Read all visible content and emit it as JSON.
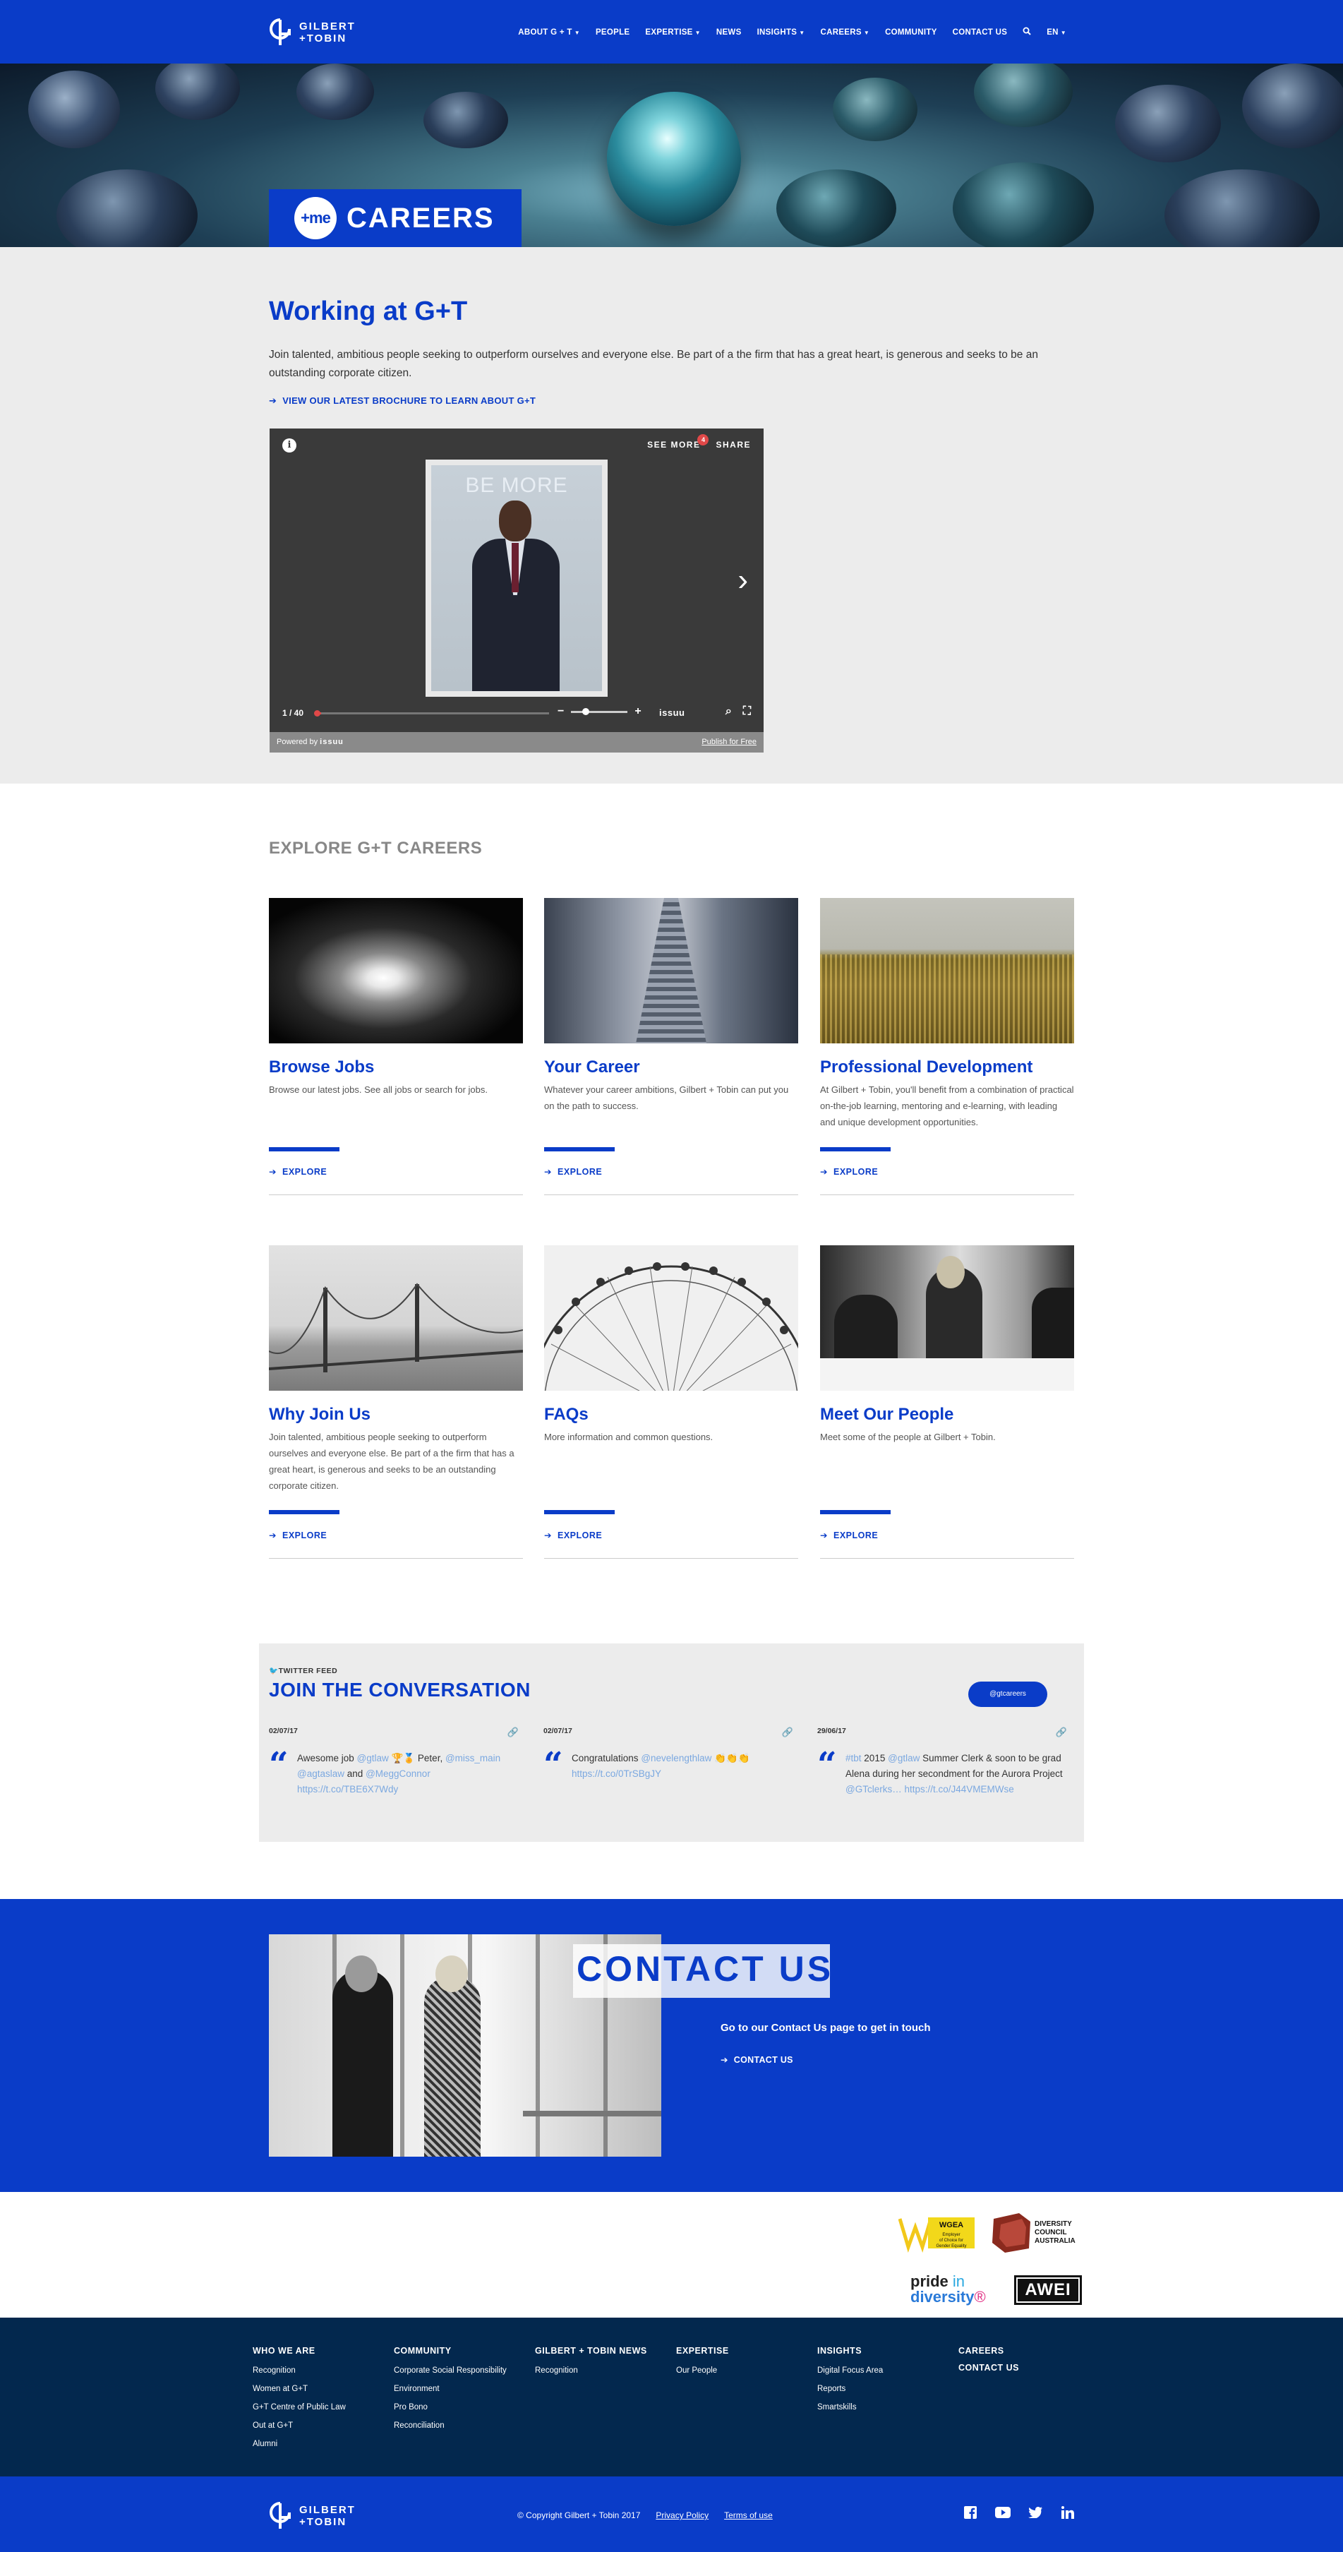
{
  "brand": {
    "logo_line1": "GILBERT",
    "logo_line2": "+TOBIN"
  },
  "nav": {
    "items": [
      {
        "label": "ABOUT G + T",
        "dropdown": true
      },
      {
        "label": "PEOPLE",
        "dropdown": false
      },
      {
        "label": "EXPERTISE",
        "dropdown": true
      },
      {
        "label": "NEWS",
        "dropdown": false
      },
      {
        "label": "INSIGHTS",
        "dropdown": true
      },
      {
        "label": "CAREERS",
        "dropdown": true
      },
      {
        "label": "COMMUNITY",
        "dropdown": false
      },
      {
        "label": "CONTACT US",
        "dropdown": false
      }
    ],
    "search_icon": "search-icon",
    "language": "EN"
  },
  "hero": {
    "badge_me": "+me",
    "title": "CAREERS"
  },
  "intro": {
    "heading": "Working at G+T",
    "body": "Join talented, ambitious people seeking to outperform ourselves and everyone else. Be part of a the firm that has a great heart, is generous and seeks to be an outstanding corporate citizen.",
    "brochure_link": "VIEW OUR LATEST BROCHURE TO LEARN ABOUT G+T"
  },
  "viewer": {
    "see_more": "SEE MORE",
    "see_more_count": "4",
    "share": "SHARE",
    "page_counter": "1 / 40",
    "cover_text": "BE MORE",
    "issuu_label": "issuu",
    "powered_by": "Powered by",
    "powered_brand": "issuu",
    "publish": "Publish for Free",
    "progress": 0.02
  },
  "explore": {
    "title": "EXPLORE G+T CAREERS",
    "link_label": "EXPLORE",
    "cards": [
      {
        "title": "Browse Jobs",
        "desc": "Browse our latest jobs. See all jobs or search for jobs."
      },
      {
        "title": "Your Career",
        "desc": "Whatever your career ambitions, Gilbert + Tobin can put you on the path to success."
      },
      {
        "title": "Professional Development",
        "desc": "At Gilbert + Tobin, you'll benefit from a combination of practical on-the-job learning, mentoring and e-learning, with leading and unique development opportunities."
      },
      {
        "title": "Why Join Us",
        "desc": "Join talented, ambitious people seeking to outperform ourselves and everyone else. Be part of a the firm that has a great heart, is generous and seeks to be an outstanding corporate citizen."
      },
      {
        "title": "FAQs",
        "desc": "More information and common questions."
      },
      {
        "title": "Meet Our People",
        "desc": "Meet some of the people at Gilbert + Tobin."
      }
    ]
  },
  "twitter": {
    "feed_label": "TWITTER FEED",
    "title": "JOIN THE CONVERSATION",
    "handle": "@gtcareers",
    "tweets": [
      {
        "date": "02/07/17",
        "text": "Awesome job",
        "h1": "@gtlaw",
        "text2": "Peter,",
        "h2": "@miss_main",
        "h3": "@agtaslaw",
        "and": "and",
        "h4": "@MeggConnor",
        "link": "https://t.co/TBE6X7Wdy"
      },
      {
        "date": "02/07/17",
        "text": "Congratulations",
        "h1": "@nevelengthlaw",
        "emoji": "👏👏👏",
        "link": "https://t.co/0TrSBgJY"
      },
      {
        "date": "29/06/17",
        "h1": "#tbt",
        "text": "2015",
        "h2": "@gtlaw",
        "text2": "Summer Clerk & soon to be grad Alena during her secondment for the Aurora Project",
        "h3": "@GTclerks…",
        "link": "https://t.co/J44VMEMWse"
      }
    ]
  },
  "contact": {
    "title": "CONTACT US",
    "text": "Go to our Contact Us page to get in touch",
    "link": "CONTACT US"
  },
  "awards": {
    "wgea_title": "WGEA",
    "wgea_sub": "Employer of Choice for Gender Equality",
    "dca_line1": "DIVERSITY",
    "dca_line2": "COUNCIL",
    "dca_line3": "AUSTRALIA",
    "pride_word": "pride",
    "pride_in": "in",
    "pride_diversity": "diversity",
    "awei": "AWEI"
  },
  "footer": {
    "columns": [
      {
        "title": "WHO WE ARE",
        "links": [
          "Recognition",
          "Women at G+T",
          "G+T Centre of Public Law",
          "Out at G+T",
          "Alumni"
        ]
      },
      {
        "title": "COMMUNITY",
        "links": [
          "Corporate Social Responsibility",
          "Environment",
          "Pro Bono",
          "Reconciliation"
        ]
      },
      {
        "title": "GILBERT + TOBIN NEWS",
        "links": [
          "Recognition"
        ]
      },
      {
        "title": "EXPERTISE",
        "links": [
          "Our People"
        ]
      },
      {
        "title": "INSIGHTS",
        "links": [
          "Digital Focus Area",
          "Reports",
          "Smartskills"
        ]
      },
      {
        "title": "CAREERS",
        "links": [
          "CONTACT US"
        ]
      }
    ],
    "copyright": "© Copyright Gilbert + Tobin 2017",
    "privacy": "Privacy Policy",
    "terms": "Terms of use",
    "socials": [
      "facebook-icon",
      "youtube-icon",
      "twitter-icon",
      "linkedin-icon"
    ]
  },
  "colors": {
    "brand_blue": "#0a3cc8",
    "navy": "#03284e",
    "light_grey": "#ececec"
  }
}
